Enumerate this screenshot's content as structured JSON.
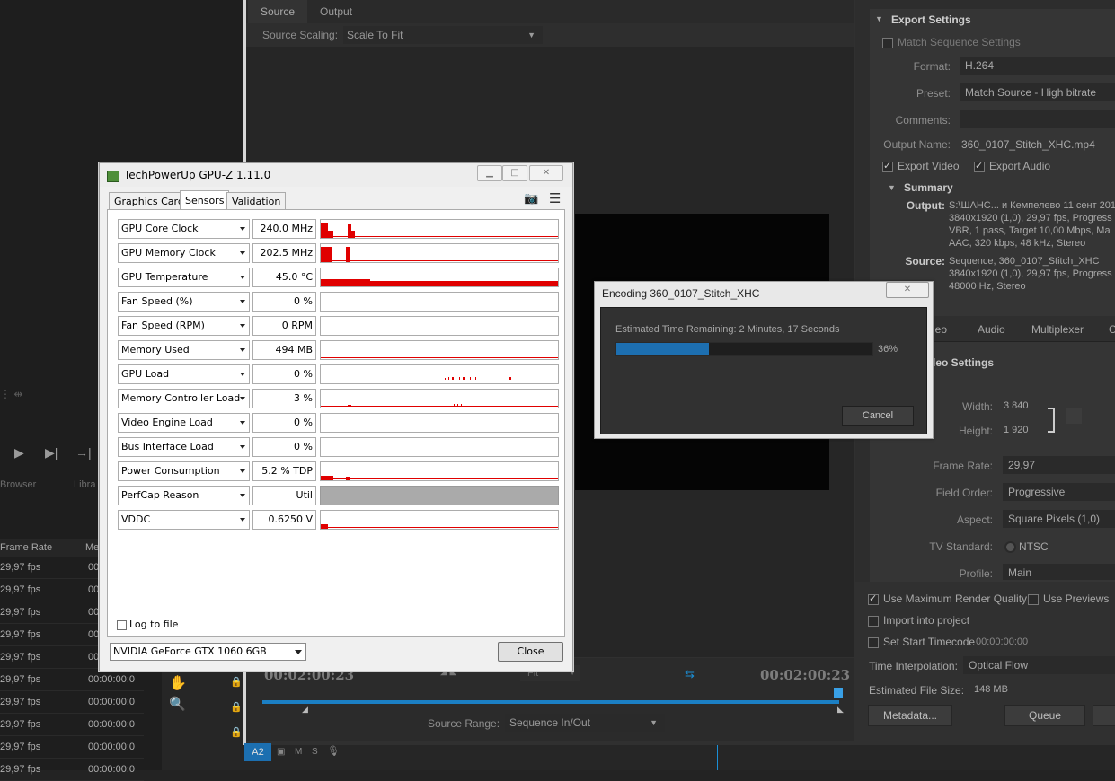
{
  "left": {
    "transport_icons": [
      "play-icon",
      "step-forward-icon",
      "go-to-out-icon"
    ],
    "tabs": [
      "Browser",
      "Libra"
    ],
    "columns": [
      "Frame Rate",
      "Me"
    ],
    "rows": [
      {
        "fps": "29,97 fps",
        "tc": "00"
      },
      {
        "fps": "29,97 fps",
        "tc": "00"
      },
      {
        "fps": "29,97 fps",
        "tc": "00"
      },
      {
        "fps": "29,97 fps",
        "tc": "00"
      },
      {
        "fps": "29,97 fps",
        "tc": "00"
      },
      {
        "fps": "29,97 fps",
        "tc": "00:00:00:0"
      },
      {
        "fps": "29,97 fps",
        "tc": "00:00:00:0"
      },
      {
        "fps": "29,97 fps",
        "tc": "00:00:00:0"
      },
      {
        "fps": "29,97 fps",
        "tc": "00:00:00:0"
      },
      {
        "fps": "29,97 fps",
        "tc": "00:00:00:0"
      }
    ]
  },
  "export": {
    "tabs": [
      "Source",
      "Output"
    ],
    "source_scaling_label": "Source Scaling:",
    "source_scaling_value": "Scale To Fit",
    "timecode_left": "00:02:00:23",
    "timecode_right": "00:02:00:23",
    "fit_value": "Fit",
    "source_range_label": "Source Range:",
    "source_range_value": "Sequence In/Out"
  },
  "settings": {
    "header": "Export Settings",
    "match_sequence": "Match Sequence Settings",
    "format_label": "Format:",
    "format_value": "H.264",
    "preset_label": "Preset:",
    "preset_value": "Match Source - High bitrate",
    "comments_label": "Comments:",
    "output_name_label": "Output Name:",
    "output_name_value": "360_0107_Stitch_XHC.mp4",
    "export_video": "Export Video",
    "export_audio": "Export Audio",
    "summary_header": "Summary",
    "output_label": "Output:",
    "output_lines": [
      "S:\\ШАНС... и Кемпелево 11 сент 201",
      "3840x1920 (1,0), 29,97 fps, Progress",
      "VBR, 1 pass, Target 10,00 Mbps, Ma",
      "AAC, 320 kbps, 48 kHz, Stereo"
    ],
    "source_label": "Source:",
    "source_lines": [
      "Sequence, 360_0107_Stitch_XHC",
      "3840x1920 (1,0), 29,97 fps, Progress",
      "48000 Hz, Stereo"
    ],
    "tabs": [
      "deo",
      "Audio",
      "Multiplexer",
      "C"
    ],
    "video_settings_header": "deo Settings",
    "width_label": "Width:",
    "width_value": "3 840",
    "height_label": "Height:",
    "height_value": "1 920",
    "frame_rate_label": "Frame Rate:",
    "frame_rate_value": "29,97",
    "field_order_label": "Field Order:",
    "field_order_value": "Progressive",
    "aspect_label": "Aspect:",
    "aspect_value": "Square Pixels (1,0)",
    "tv_standard_label": "TV Standard:",
    "tv_standard_value": "NTSC",
    "profile_label": "Profile:",
    "profile_value": "Main",
    "max_render": "Use Maximum Render Quality",
    "use_previews": "Use Previews",
    "import_project": "Import into project",
    "set_start_tc": "Set Start Timecode",
    "start_tc_value": "00:00:00:00",
    "interp_label": "Time Interpolation:",
    "interp_value": "Optical Flow",
    "file_size_label": "Estimated File Size:",
    "file_size_value": "148 MB",
    "metadata_btn": "Metadata...",
    "queue_btn": "Queue"
  },
  "gpuz": {
    "title": "TechPowerUp GPU-Z 1.11.0",
    "tabs": [
      "Graphics Card",
      "Sensors",
      "Validation"
    ],
    "sensors": [
      {
        "name": "GPU Core Clock",
        "value": "240.0 MHz"
      },
      {
        "name": "GPU Memory Clock",
        "value": "202.5 MHz"
      },
      {
        "name": "GPU Temperature",
        "value": "45.0 °C"
      },
      {
        "name": "Fan Speed (%)",
        "value": "0 %"
      },
      {
        "name": "Fan Speed (RPM)",
        "value": "0 RPM"
      },
      {
        "name": "Memory Used",
        "value": "494 MB"
      },
      {
        "name": "GPU Load",
        "value": "0 %"
      },
      {
        "name": "Memory Controller Load",
        "value": "3 %"
      },
      {
        "name": "Video Engine Load",
        "value": "0 %"
      },
      {
        "name": "Bus Interface Load",
        "value": "0 %"
      },
      {
        "name": "Power Consumption",
        "value": "5.2 % TDP"
      },
      {
        "name": "PerfCap Reason",
        "value": "Util"
      },
      {
        "name": "VDDC",
        "value": "0.6250 V"
      }
    ],
    "log_to_file": "Log to file",
    "gpu_select": "NVIDIA GeForce GTX 1060 6GB",
    "close_btn": "Close",
    "graph_color": "#e00000"
  },
  "encoding": {
    "title": "Encoding 360_0107_Stitch_XHC",
    "remaining": "Estimated Time Remaining: 2 Minutes, 17 Seconds",
    "progress_fraction": 0.36,
    "percent_text": "36%",
    "cancel": "Cancel"
  },
  "track": {
    "a2": "A2",
    "m": "M",
    "s": "S"
  }
}
